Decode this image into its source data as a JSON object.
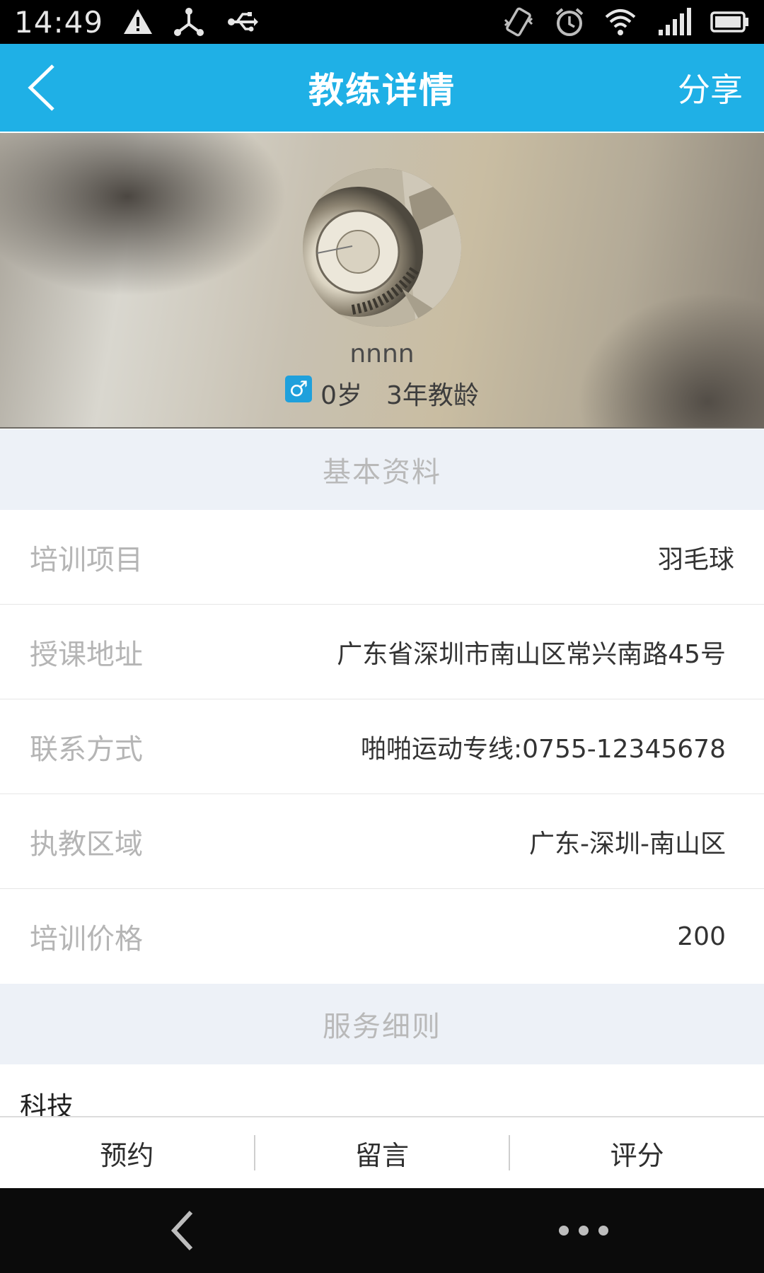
{
  "status_bar": {
    "time": "14:49",
    "icons_left": [
      "warning-icon",
      "usb-tether-icon",
      "usb-icon"
    ],
    "icons_right": [
      "vibrate-icon",
      "alarm-icon",
      "wifi-icon",
      "signal-icon",
      "battery-icon"
    ]
  },
  "header": {
    "title": "教练详情",
    "share_label": "分享",
    "back_icon": "chevron-left-icon",
    "color": "#1fb0e6"
  },
  "profile": {
    "name": "nnnn",
    "gender_symbol": "♂",
    "age": "0岁",
    "experience": "3年教龄"
  },
  "basic_section": {
    "title": "基本资料",
    "rows": [
      {
        "label": "培训项目",
        "value": "羽毛球"
      },
      {
        "label": "授课地址",
        "value": "广东省深圳市南山区常兴南路45号"
      },
      {
        "label": "联系方式",
        "value": "啪啪运动专线:0755-12345678"
      },
      {
        "label": "执教区域",
        "value": "广东-深圳-南山区"
      },
      {
        "label": "培训价格",
        "value": "200"
      }
    ]
  },
  "service_section": {
    "title": "服务细则",
    "content": "科技"
  },
  "action_bar": {
    "book_label": "预约",
    "message_label": "留言",
    "rate_label": "评分"
  }
}
